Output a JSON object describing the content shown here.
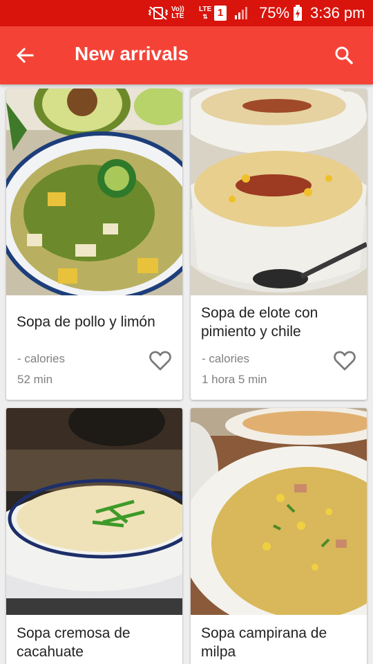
{
  "status_bar": {
    "battery_percent": "75%",
    "clock": "3:36 pm",
    "network_top": "LTE",
    "sim_slot": "1",
    "volte_top": "Vo))",
    "volte_bottom": "LTE",
    "icons": [
      "vibrate-icon",
      "volte-icon",
      "lte-data-icon",
      "sim-icon",
      "signal-icon",
      "battery-charging-icon"
    ]
  },
  "app_bar": {
    "title": "New arrivals",
    "back_icon": "arrow-back-icon",
    "search_icon": "search-icon"
  },
  "recipes": [
    {
      "name": "Sopa de pollo y limón",
      "calories": "- calories",
      "time": "52 min",
      "favorite_icon": "heart-outline-icon"
    },
    {
      "name": "Sopa de elote con pimiento y chile",
      "calories": "- calories",
      "time": "1 hora 5 min",
      "favorite_icon": "heart-outline-icon"
    },
    {
      "name": "Sopa cremosa de cacahuate"
    },
    {
      "name": "Sopa campirana de milpa"
    }
  ],
  "colors": {
    "status_bar": "#d9140c",
    "app_bar": "#f44336",
    "background": "#eeeeee",
    "secondary_text": "#808080"
  }
}
